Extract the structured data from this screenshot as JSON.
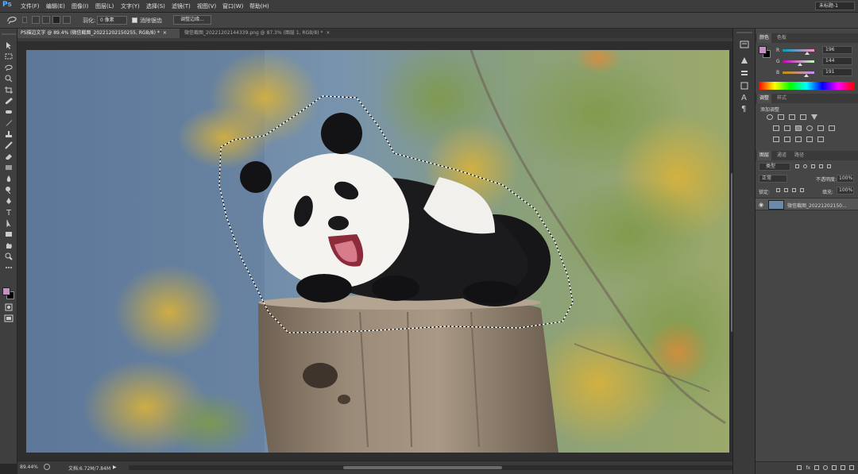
{
  "menubar": {
    "logo": "Ps",
    "items": [
      "文件(F)",
      "编辑(E)",
      "图像(I)",
      "图层(L)",
      "文字(Y)",
      "选择(S)",
      "滤镜(T)",
      "视图(V)",
      "窗口(W)",
      "帮助(H)"
    ],
    "workspace": "未标题-1"
  },
  "options": {
    "feather_label": "羽化:",
    "feather_value": "0 像素",
    "antialias_label": "消除锯齿",
    "refine_edge": "调整边缘..."
  },
  "tabs": [
    {
      "label": "PS描边文字 @ 89.4% (微信截图_20221202150255, RGB/8) *",
      "active": true
    },
    {
      "label": "微信截图_20221202144339.png @ 87.3% (图层 1, RGB/8) *",
      "active": false
    }
  ],
  "status": {
    "zoom": "89.44%",
    "doc": "文档:6.72M/7.84M"
  },
  "color_panel": {
    "tabs": [
      "颜色",
      "色板"
    ],
    "channels": [
      {
        "label": "R",
        "value": "196",
        "level": 0.77
      },
      {
        "label": "G",
        "value": "144",
        "level": 0.56
      },
      {
        "label": "B",
        "value": "191",
        "level": 0.75
      }
    ],
    "fg_color": "#c490bf"
  },
  "adjust_panel": {
    "tabs": [
      "调整",
      "样式"
    ],
    "title": "添加调整"
  },
  "layers_panel": {
    "tabs": [
      "图层",
      "通道",
      "路径"
    ],
    "kind": "类型",
    "blend": "正常",
    "opacity_label": "不透明度:",
    "opacity": "100%",
    "lock_label": "锁定:",
    "fill_label": "填充:",
    "fill": "100%",
    "layers": [
      {
        "name": "微信截图_20221202150..."
      }
    ]
  }
}
